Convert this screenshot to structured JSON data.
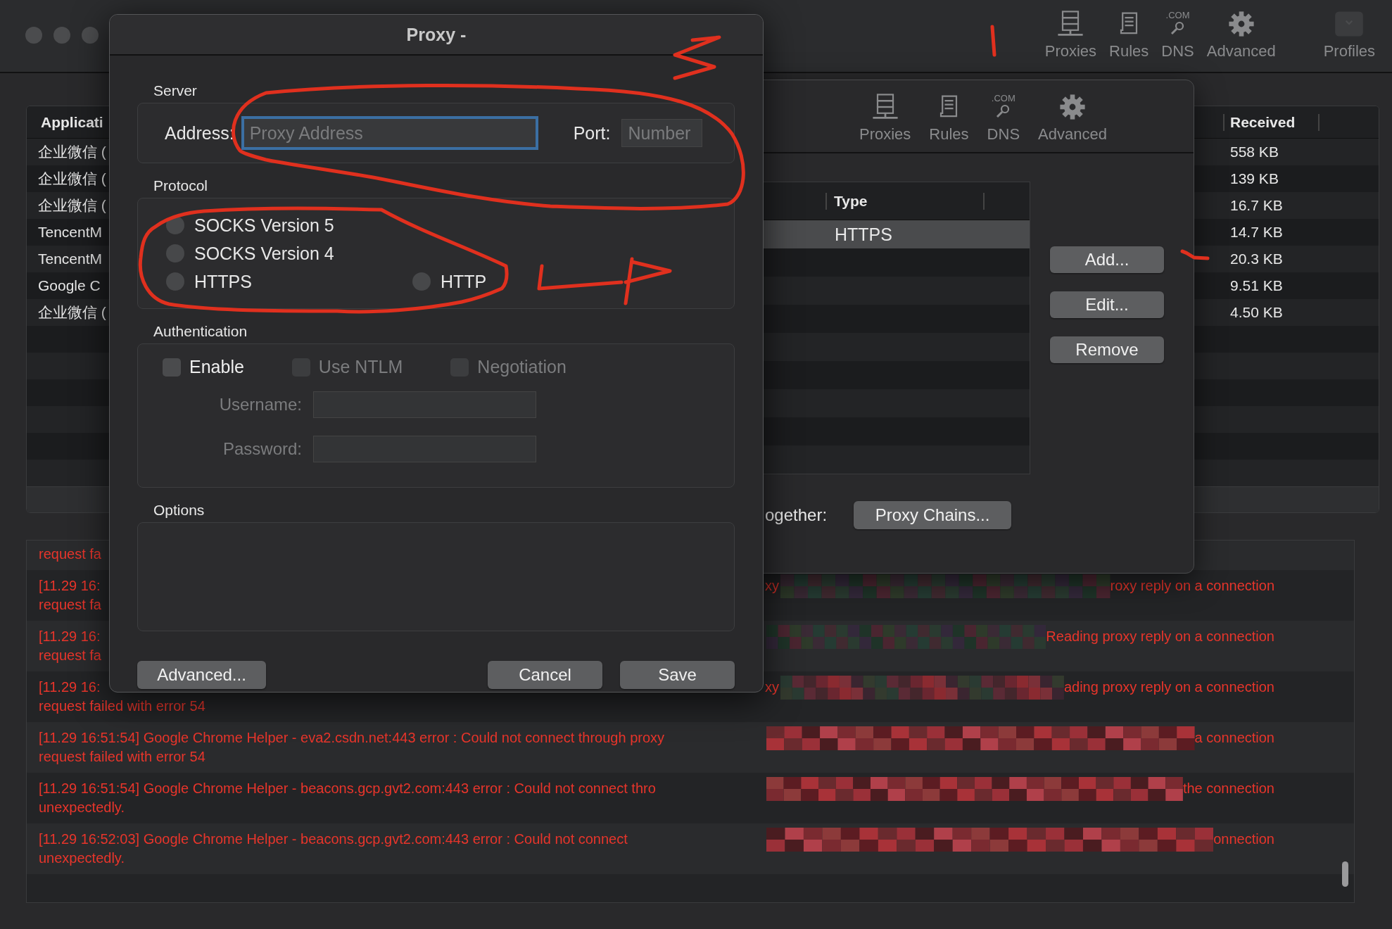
{
  "main_window": {
    "toolbar": [
      {
        "kind": "proxies",
        "label": "Proxies"
      },
      {
        "kind": "rules",
        "label": "Rules"
      },
      {
        "kind": "dns",
        "badge": ".COM",
        "label": "DNS"
      },
      {
        "kind": "advanced",
        "label": "Advanced"
      },
      {
        "kind": "profiles",
        "label": "Profiles"
      }
    ],
    "connections": {
      "columns": [
        "Applicati",
        "Received"
      ],
      "rows": [
        {
          "application": "企业微信 (",
          "received": "558 KB"
        },
        {
          "application": "企业微信 (",
          "received": "139 KB"
        },
        {
          "application": "企业微信 (",
          "received": "16.7 KB"
        },
        {
          "application": "TencentM",
          "received": "14.7 KB"
        },
        {
          "application": "TencentM",
          "received": "20.3 KB"
        },
        {
          "application": "Google C",
          "received": "9.51 KB"
        },
        {
          "application": "企业微信 (",
          "received": "4.50 KB"
        }
      ]
    },
    "log": [
      {
        "continuation": "request fa"
      },
      {
        "text": "[11.29 16:",
        "mid": "xy",
        "right": "roxy reply on a connection",
        "continuation": "request fa"
      },
      {
        "text": "[11.29 16:",
        "right": "Reading proxy reply on a connection",
        "continuation": "request fa"
      },
      {
        "text": "[11.29 16:",
        "mid": "xy",
        "right": "ading proxy reply on a connection",
        "continuation": "request failed with error 54"
      },
      {
        "text": "[11.29 16:51:54] Google Chrome Helper - eva2.csdn.net:443 error : Could not connect through proxy",
        "right": "a connection",
        "continuation": "request failed with error 54"
      },
      {
        "text": "[11.29 16:51:54] Google Chrome Helper - beacons.gcp.gvt2.com:443 error : Could not connect thro",
        "right": "the connection",
        "continuation": "unexpectedly."
      },
      {
        "text": "[11.29 16:52:03] Google Chrome Helper - beacons.gcp.gvt2.com:443 error : Could not connect",
        "right": "onnection",
        "continuation": "unexpectedly."
      }
    ]
  },
  "proxy_servers_dialog": {
    "toolbar": [
      {
        "kind": "proxies",
        "label": "Proxies"
      },
      {
        "kind": "rules",
        "label": "Rules"
      },
      {
        "kind": "dns",
        "badge": ".COM",
        "label": "DNS"
      },
      {
        "kind": "advanced",
        "label": "Advanced"
      }
    ],
    "table": {
      "columns": [
        "Type"
      ],
      "rows": [
        {
          "type": "HTTPS",
          "selected": true
        }
      ]
    },
    "buttons": [
      "Add...",
      "Edit...",
      "Remove"
    ],
    "chains_label": "ogether:",
    "chains_button": "Proxy Chains..."
  },
  "proxy_dialog": {
    "title": "Proxy -",
    "server": {
      "label": "Server",
      "address_label": "Address:",
      "address_placeholder": "Proxy Address",
      "address_focused": true,
      "port_label": "Port:",
      "port_placeholder": "Number"
    },
    "protocol": {
      "label": "Protocol",
      "options": [
        {
          "label": "SOCKS Version 5",
          "selected": false
        },
        {
          "label": "SOCKS Version 4",
          "selected": false
        },
        {
          "label": "HTTPS",
          "selected": false
        },
        {
          "label": "HTTP",
          "selected": false
        }
      ]
    },
    "authentication": {
      "label": "Authentication",
      "checks": [
        {
          "label": "Enable",
          "checked": false,
          "disabled": false
        },
        {
          "label": "Use NTLM",
          "checked": false,
          "disabled": true
        },
        {
          "label": "Negotiation",
          "checked": false,
          "disabled": true
        }
      ],
      "username_label": "Username:",
      "password_label": "Password:",
      "fields_disabled": true
    },
    "options": {
      "label": "Options"
    },
    "buttons": {
      "advanced": "Advanced...",
      "cancel": "Cancel",
      "save": "Save"
    }
  }
}
